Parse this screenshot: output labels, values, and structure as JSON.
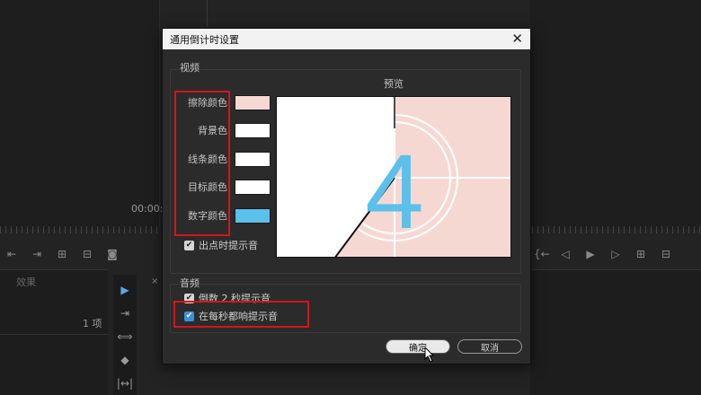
{
  "background": {
    "timecode": "00:00:0",
    "item_count": "1 项",
    "effects_tab": "效果",
    "tab_close": "×"
  },
  "dialog": {
    "title": "通用倒计时设置",
    "close_glyph": "✕",
    "video_section": "视频",
    "preview_label": "预览",
    "colors": [
      {
        "label": "擦除颜色",
        "color": "#f6d8d3"
      },
      {
        "label": "背景色",
        "color": "#ffffff"
      },
      {
        "label": "线条颜色",
        "color": "#ffffff"
      },
      {
        "label": "目标颜色",
        "color": "#ffffff"
      },
      {
        "label": "数字颜色",
        "color": "#5bc0ea"
      }
    ],
    "cue_out_label": "出点时提示音",
    "audio_section": "音频",
    "beep_two_label": "倒数 2 秒提示音",
    "beep_each_label": "在每秒都响提示音",
    "ok_label": "确定",
    "cancel_label": "取消",
    "preview_digit": "4"
  },
  "colors": {
    "wipe": "#f6d8d3",
    "digit": "#5bc0ea",
    "highlight": "#d6141b",
    "checkbox_active": "#3c8fde"
  }
}
